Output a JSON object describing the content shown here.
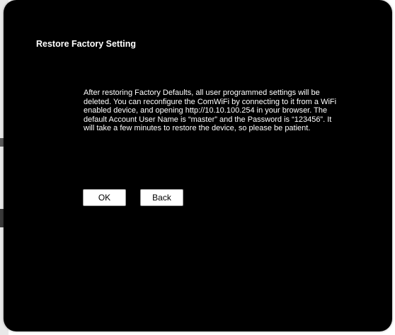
{
  "dialog": {
    "title": "Restore Factory Setting",
    "message": "After restoring Factory Defaults, all user programmed settings will be deleted. You can reconfigure the ComWiFi by connecting to it from a WiFi enabled device, and opening http://10.10.100.254 in your browser. The default Account User Name is “master” and the Password is “123456”. It will take a few minutes to restore the device, so please be patient.",
    "ok_label": "OK",
    "back_label": "Back"
  },
  "colors": {
    "dialog_background": "#000000",
    "text": "#ffffff",
    "button_background": "#ffffff",
    "button_text": "#000000"
  }
}
